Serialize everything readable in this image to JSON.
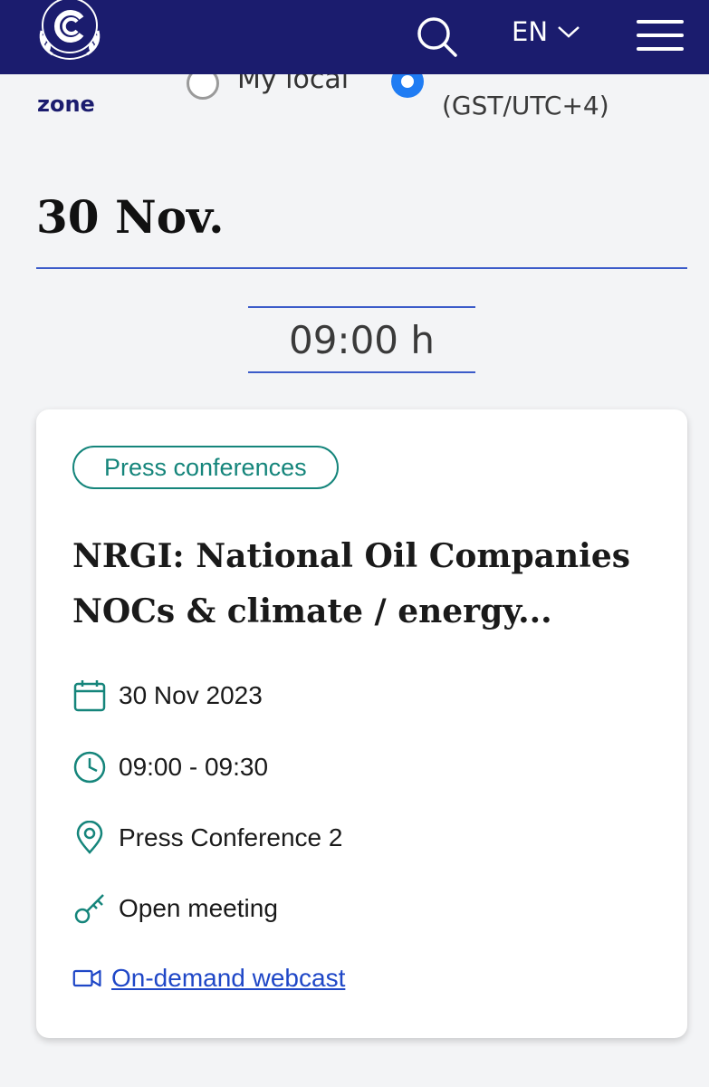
{
  "header": {
    "language": "EN",
    "search_icon": "search-icon",
    "menu_icon": "hamburger-menu-icon",
    "logo": "un-climate-change-logo",
    "background": "#1b1c6e"
  },
  "timezone": {
    "label": "zone",
    "options": [
      {
        "label": "My local",
        "selected": false
      },
      {
        "label": "(GST/UTC+4)",
        "selected": true
      }
    ]
  },
  "day": {
    "heading": "30 Nov."
  },
  "slot": {
    "time": "09:00 h"
  },
  "event": {
    "tag": "Press conferences",
    "title": "NRGI: National Oil Companies NOCs & climate / energy...",
    "date": "30 Nov 2023",
    "time": "09:00 - 09:30",
    "location": "Press Conference 2",
    "access": "Open meeting",
    "webcast": "On-demand webcast"
  },
  "colors": {
    "accent_teal": "#15857b",
    "link_blue": "#1f47c7",
    "rule_blue": "#3b5bc9",
    "radio_blue": "#1f7cf3"
  }
}
